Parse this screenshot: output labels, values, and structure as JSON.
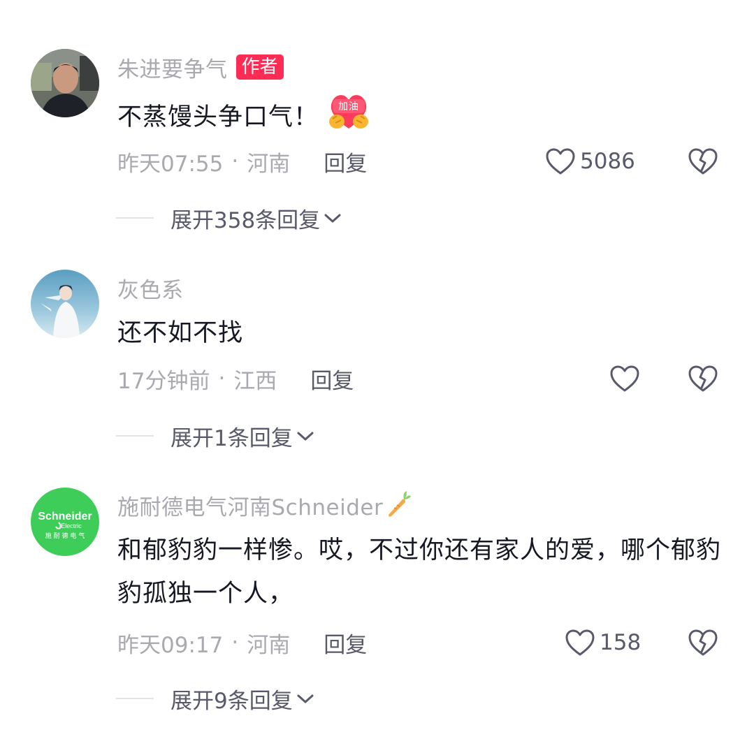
{
  "comments": [
    {
      "username": "朱进要争气",
      "badge": "作者",
      "text": "不蒸馒头争口气！",
      "emoji_label": "加油",
      "time": "昨天07:55",
      "location": "河南",
      "reply_label": "回复",
      "likes": "5086",
      "expand_label": "展开358条回复"
    },
    {
      "username": "灰色系",
      "text": "还不如不找",
      "time": "17分钟前",
      "location": "江西",
      "reply_label": "回复",
      "likes": "",
      "expand_label": "展开1条回复"
    },
    {
      "username": "施耐德电气河南Schneider",
      "avatar_text": "Schneider",
      "avatar_subtext": "Electric",
      "avatar_cn": "施 耐 德 电 气",
      "text": "和郁豹豹一样惨。哎，不过你还有家人的爱，哪个郁豹豹孤独一个人，",
      "time": "昨天09:17",
      "location": "河南",
      "reply_label": "回复",
      "likes": "158",
      "expand_label": "展开9条回复"
    }
  ],
  "meta_separator": "·",
  "colors": {
    "badge": "#fe2c55",
    "username": "#a9a9b0",
    "text": "#161823",
    "action": "#58596a",
    "schneider_green": "#3dcd58"
  },
  "icons": {
    "like": "heart-outline-icon",
    "dislike": "broken-heart-icon",
    "expand": "chevron-down-icon",
    "emoji": "cheer-emoji-icon",
    "username_decoration": "carrot-icon"
  }
}
